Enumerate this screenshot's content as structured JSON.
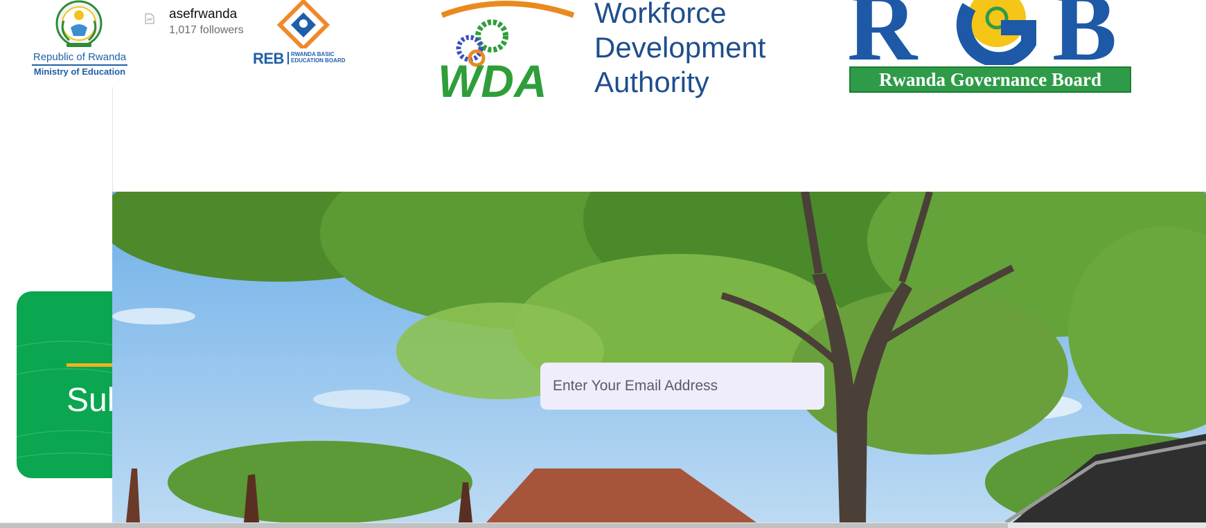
{
  "logos": {
    "ministry": {
      "line1": "Republic of Rwanda",
      "line2": "Ministry of Education",
      "icon": "rwanda-coat-of-arms-icon"
    },
    "reb": {
      "abbr": "REB",
      "line1": "RWANDA BASIC",
      "line2": "EDUCATION BOARD",
      "icon": "reb-diamond-icon"
    },
    "wda": {
      "line1": "Workforce",
      "line2": "Development",
      "line3": "Authority",
      "icon": "wda-gears-icon"
    },
    "rgb": {
      "band": "Rwanda Governance Board",
      "icon": "rgb-sun-icon"
    }
  },
  "social": {
    "handle": "asefrwanda",
    "followers": "1,017 followers",
    "icon": "broken-image-icon"
  },
  "subscribe": {
    "heading": "Sub"
  },
  "newsletter": {
    "email_placeholder": "Enter Your Email Address",
    "email_value": ""
  },
  "colors": {
    "card_green": "#0aa650",
    "accent_orange": "#f5b21c",
    "brand_blue": "#1f5fa8",
    "rgb_green": "#2e9b48"
  }
}
